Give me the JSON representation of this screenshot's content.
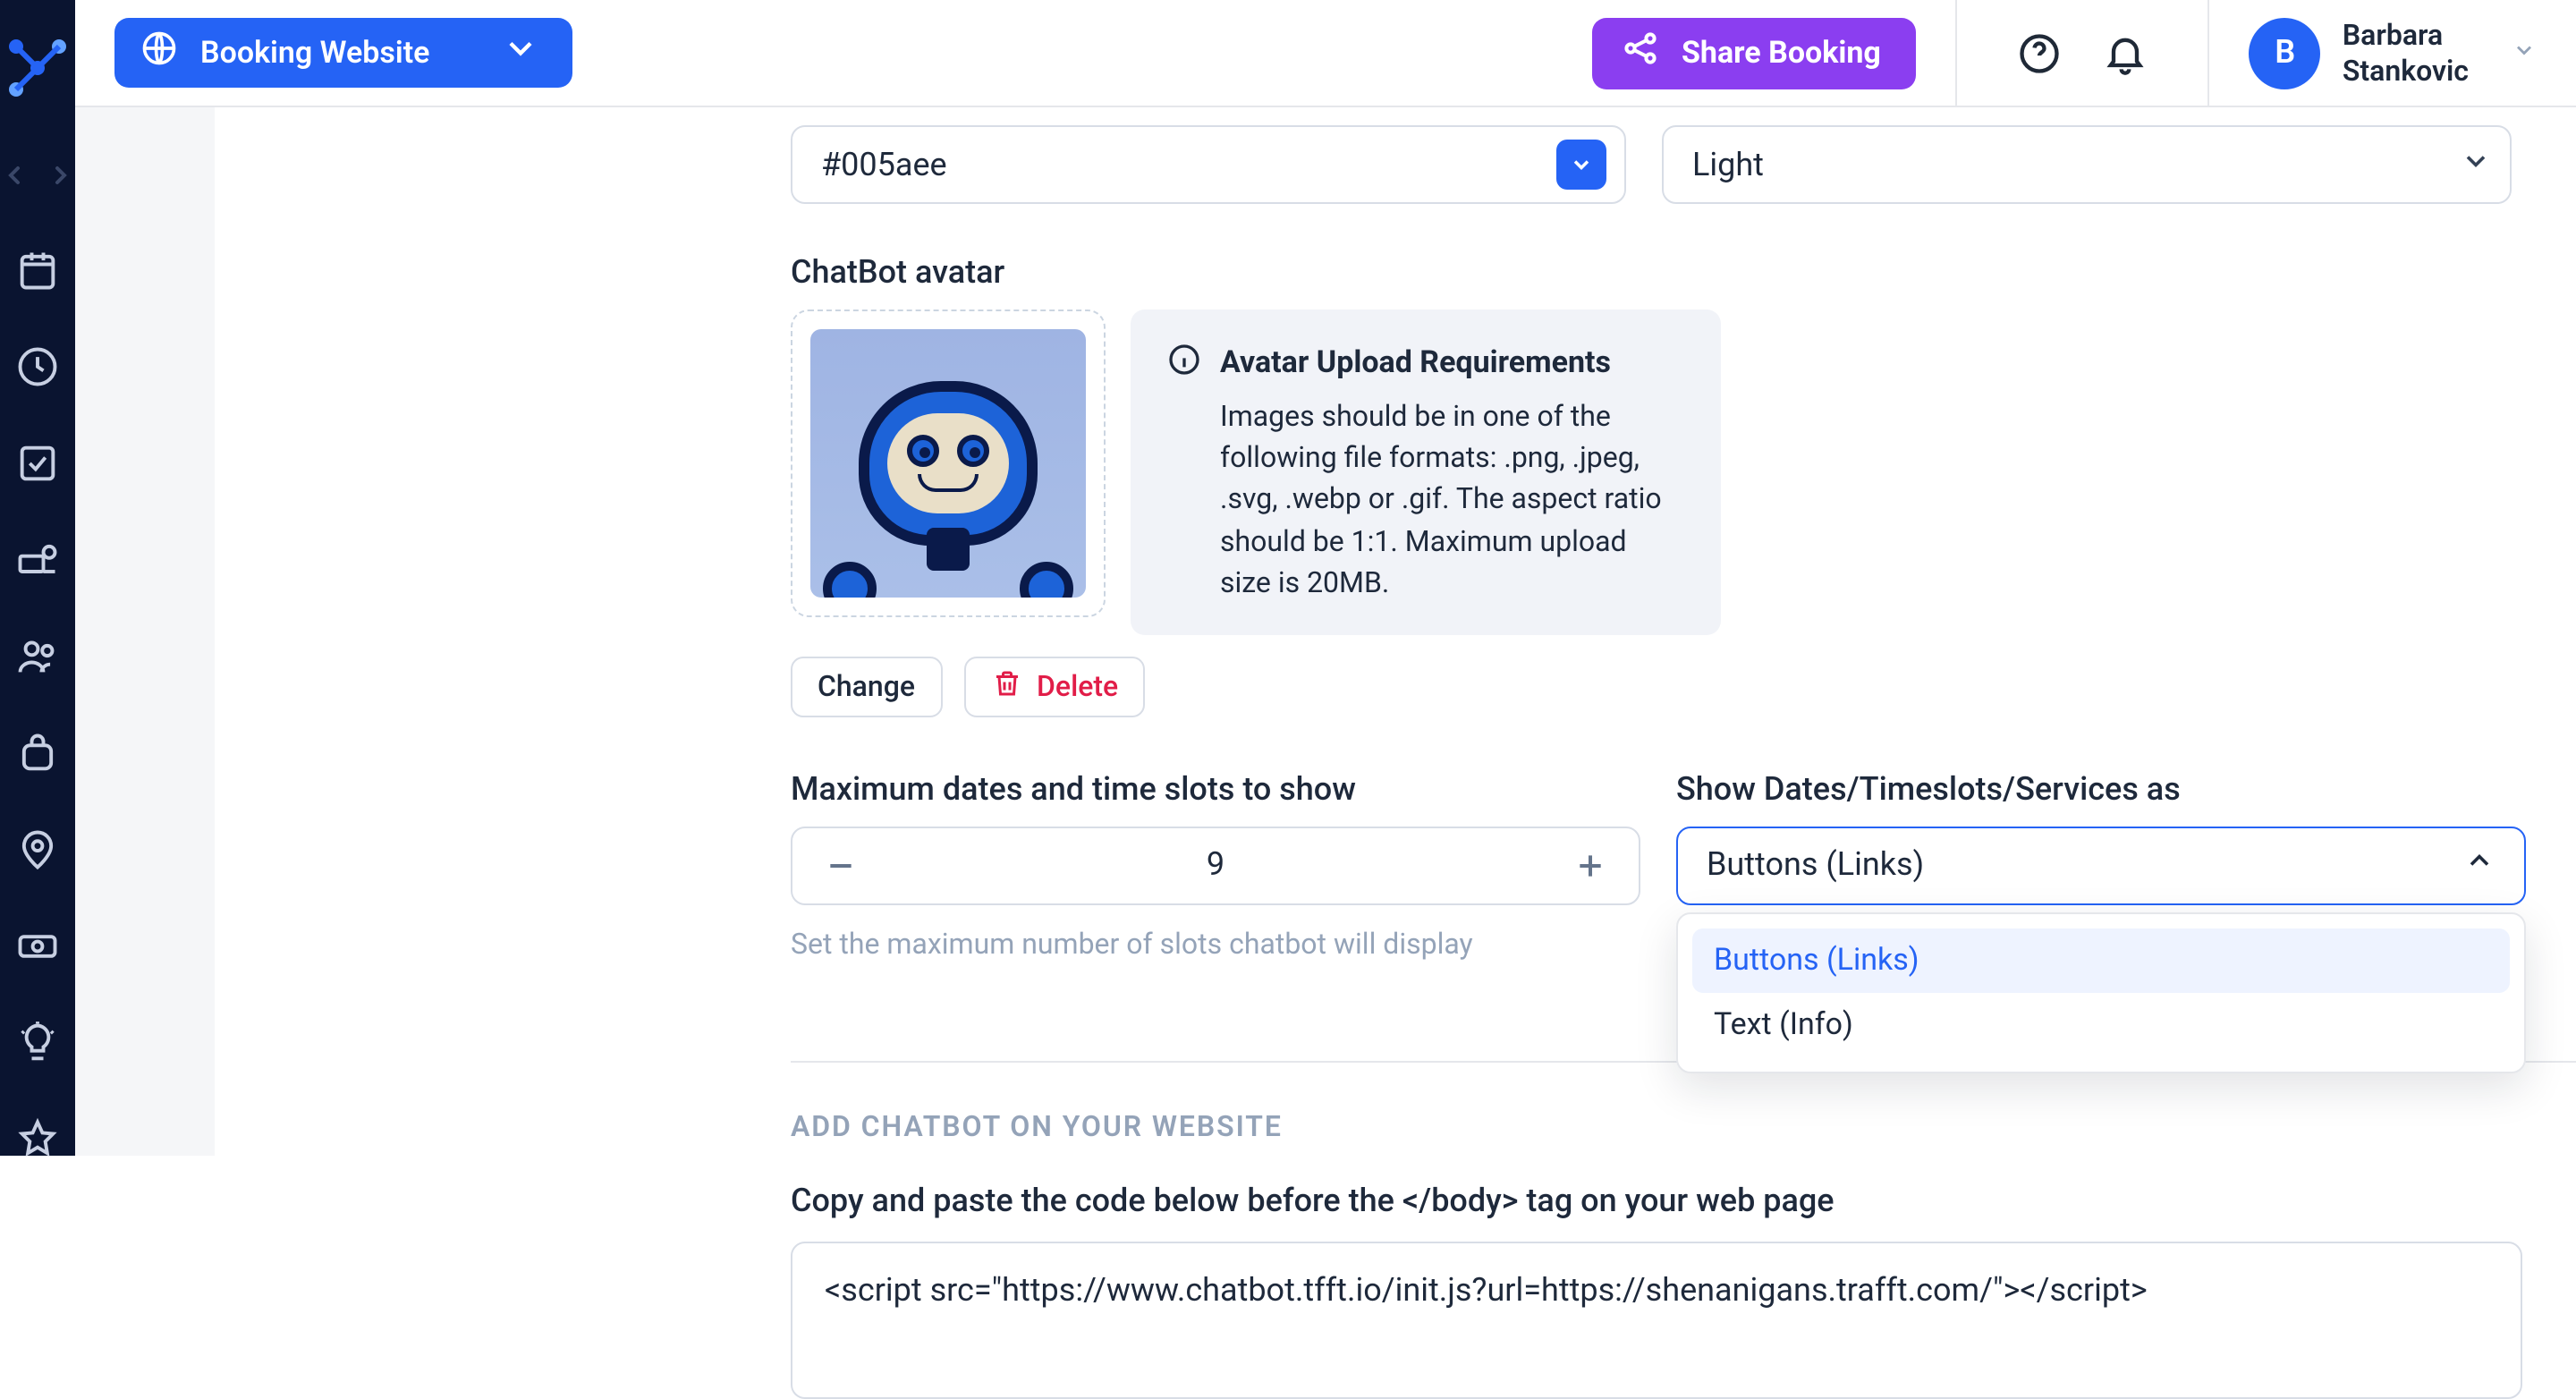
{
  "header": {
    "pill_label": "Booking Website",
    "share_label": "Share Booking",
    "user_initial": "B",
    "user_first": "Barbara",
    "user_last": "Stankovic"
  },
  "colors": {
    "primary_hex": "#005aee",
    "theme_label": "Light"
  },
  "avatar": {
    "section_label": "ChatBot avatar",
    "req_title": "Avatar Upload Requirements",
    "req_body": "Images should be in one of the following file formats: .png, .jpeg, .svg, .webp or .gif. The aspect ratio should be 1:1. Maximum upload size is 20MB.",
    "change_label": "Change",
    "delete_label": "Delete"
  },
  "slots": {
    "label": "Maximum dates and time slots to show",
    "value": "9",
    "hint": "Set the maximum number of slots chatbot will display"
  },
  "showAs": {
    "label": "Show Dates/Timeslots/Services as",
    "selected": "Buttons (Links)",
    "options": [
      "Buttons (Links)",
      "Text (Info)"
    ]
  },
  "embed": {
    "section_title": "ADD CHATBOT ON YOUR WEBSITE",
    "copy_label": "Copy and paste the code below before the </body> tag on your web page",
    "code": "<script src=\"https://www.chatbot.tfft.io/init.js?url=https://shenanigans.trafft.com/\"></script>"
  }
}
